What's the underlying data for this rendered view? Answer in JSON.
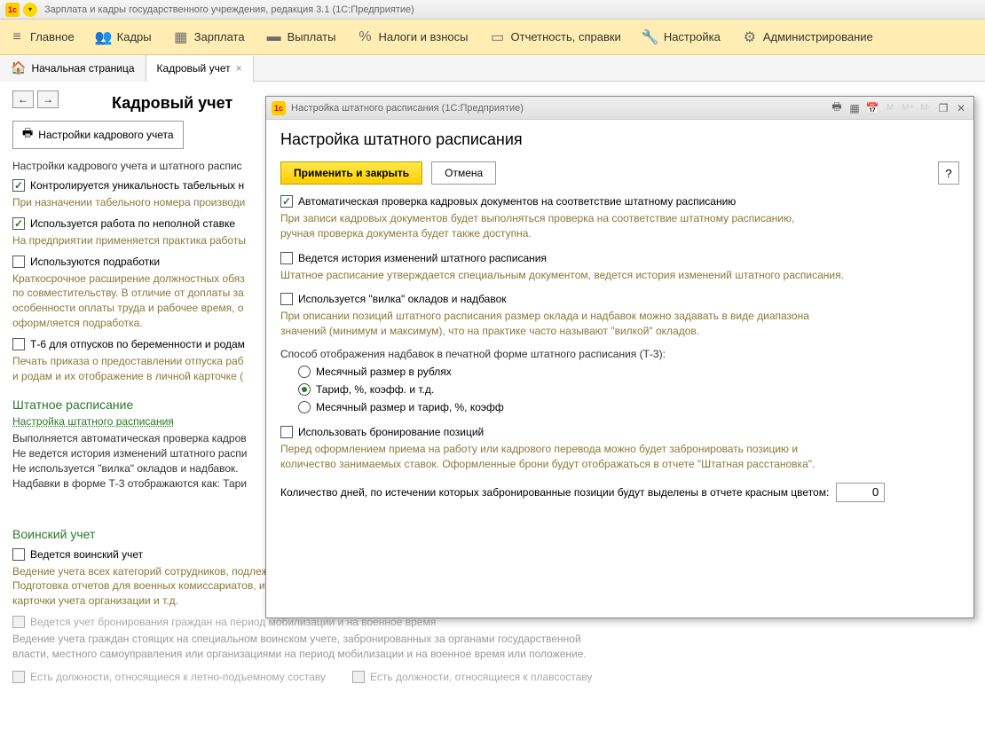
{
  "title_bar": {
    "text": "Зарплата и кадры государственного учреждения, редакция 3.1  (1С:Предприятие)"
  },
  "menu": {
    "items": [
      {
        "label": "Главное",
        "icon": "≡"
      },
      {
        "label": "Кадры",
        "icon": "👥"
      },
      {
        "label": "Зарплата",
        "icon": "▦"
      },
      {
        "label": "Выплаты",
        "icon": "▬"
      },
      {
        "label": "Налоги и взносы",
        "icon": "%"
      },
      {
        "label": "Отчетность, справки",
        "icon": "▭"
      },
      {
        "label": "Настройка",
        "icon": "🔧"
      },
      {
        "label": "Администрирование",
        "icon": "⚙"
      }
    ]
  },
  "tabs": {
    "home": "Начальная страница",
    "active": "Кадровый учет"
  },
  "page": {
    "title": "Кадровый учет",
    "settings_btn": "Настройки кадрового учета",
    "section1_text": "Настройки кадрового учета и штатного распис",
    "cb1": "Контролируется уникальность табельных н",
    "olive1": "При назначении табельного номера производи",
    "cb2": "Используется работа по неполной ставке",
    "olive2": "На предприятии применяется практика работы",
    "cb3": "Используются подработки",
    "olive3": "Краткосрочное расширение должностных обяз\nпо совместительству. В отличие от доплаты за\nособенности оплаты труда и рабочее время, о\nоформляется подработка.",
    "cb4": "Т-6 для отпусков по беременности и родам",
    "olive4": "Печать приказа о предоставлении отпуска раб\nи родам и их отображение в личной карточке (",
    "section2_header": "Штатное расписание",
    "section2_link": "Настройка штатного расписания",
    "dark1": "Выполняется автоматическая проверка кадров\nНе ведется история изменений штатного распи\nНе используется \"вилка\" окладов и надбавок.\nНадбавки в форме Т-3 отображаются как: Тари",
    "section3_header": "Воинский учет",
    "cb5": "Ведется воинский учет",
    "olive5": "Ведение учета всех категорий сотрудников, подлежащих воинскому учету и сотрудников пребывающих в запасе.\nПодготовка отчетов для военных комиссариатов, извещений о приеме на работу граждан подлежащих воинскому учету,\nкарточки учета организации и т.д.",
    "cb6": "Ведется учет бронирования граждан на период мобилизации и на военное время",
    "gray1": "Ведение учета граждан стоящих на специальном воинском учете, забронированных за органами государственной\nвласти, местного самоуправления или организациями на период мобилизации и на военное время или положение.",
    "cb7": "Есть должности, относящиеся к летно-подъемному составу",
    "cb8": "Есть должности, относящиеся к плавсоставу"
  },
  "dialog": {
    "title": "Настройка штатного расписания  (1С:Предприятие)",
    "heading": "Настройка штатного расписания",
    "apply_btn": "Применить и закрыть",
    "cancel_btn": "Отмена",
    "help": "?",
    "cb1": "Автоматическая проверка кадровых документов на соответствие штатному расписанию",
    "olive1": "При записи кадровых документов будет выполняться проверка на соответствие штатному расписанию,\nручная проверка документа будет также доступна.",
    "cb2": "Ведется история изменений штатного расписания",
    "olive2": "Штатное расписание утверждается специальным документом, ведется история изменений штатного расписания.",
    "cb3": "Используется \"вилка\" окладов и надбавок",
    "olive3": "При описании позиций штатного расписания размер оклада и надбавок можно задавать в виде диапазона\nзначений (минимум и максимум), что на практике часто называют \"вилкой\" окладов.",
    "radio_label": "Способ отображения надбавок в печатной форме штатного расписания (Т-3):",
    "radio1": "Месячный размер в рублях",
    "radio2": "Тариф, %, коэфф. и т.д.",
    "radio3": "Месячный размер и тариф, %, коэфф",
    "cb4": "Использовать бронирование позиций",
    "olive4": "Перед оформлением приема на работу или кадрового перевода можно будет забронировать позицию и\nколичество занимаемых ставок. Оформленные брони будут отображаться в отчете \"Штатная расстановка\".",
    "input_label": "Количество дней, по истечении которых забронированные позиции будут выделены в отчете красным цветом:",
    "input_value": "0"
  }
}
